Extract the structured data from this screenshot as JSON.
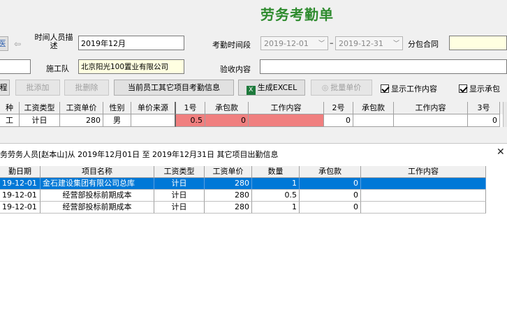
{
  "title": "劳务考勤单",
  "form": {
    "label_time_desc": "时间人员描述",
    "time_desc_value": "2019年12月",
    "label_attendance_period": "考勤时间段",
    "date_from": "2019-12-01",
    "date_sep": "–",
    "date_to": "2019-12-31",
    "label_subcontract": "分包合同",
    "label_construction_team": "施工队",
    "construction_team_value": "北京阳光100置业有限公司",
    "label_acceptance": "验收内容",
    "left_partial_button": "医",
    "nav_icon": "arrow-left-icon"
  },
  "toolbar": {
    "btn_partial": "程",
    "btn_batch_add": "批添加",
    "btn_batch_delete": "批删除",
    "btn_other_projects": "当前员工其它项目考勤信息",
    "btn_excel": "生成EXCEL",
    "btn_batch_price": "批量单价",
    "chk_show_content": "显示工作内容",
    "chk_show_contract": "显示承包"
  },
  "grid": {
    "headers": [
      "种",
      "工资类型",
      "工资单价",
      "性别",
      "单价来源",
      "1号",
      "承包款",
      "工作内容",
      "2号",
      "承包款",
      "工作内容",
      "3号"
    ],
    "row": [
      "工",
      "计日",
      "280",
      "男",
      "",
      "0.5",
      "0",
      "",
      "0",
      "",
      "",
      "0"
    ]
  },
  "popup": {
    "title": "务劳务人员[赵本山]从 2019年12月01日 至 2019年12月31日 其它项目出勤信息",
    "close": "✕",
    "headers": [
      "勤日期",
      "项目名称",
      "工资类型",
      "工资单价",
      "数量",
      "承包款",
      "工作内容"
    ],
    "rows": [
      [
        "19-12-01",
        "金石建设集团有限公司总库",
        "计日",
        "280",
        "1",
        "0",
        ""
      ],
      [
        "19-12-01",
        "经营部投标前期成本",
        "计日",
        "280",
        "0.5",
        "0",
        ""
      ],
      [
        "19-12-01",
        "经营部投标前期成本",
        "计日",
        "280",
        "1",
        "0",
        ""
      ]
    ]
  },
  "colors": {
    "title_green": "#2e8b2e",
    "highlight_pink": "#f07f7f",
    "selection_blue": "#0078d7"
  }
}
